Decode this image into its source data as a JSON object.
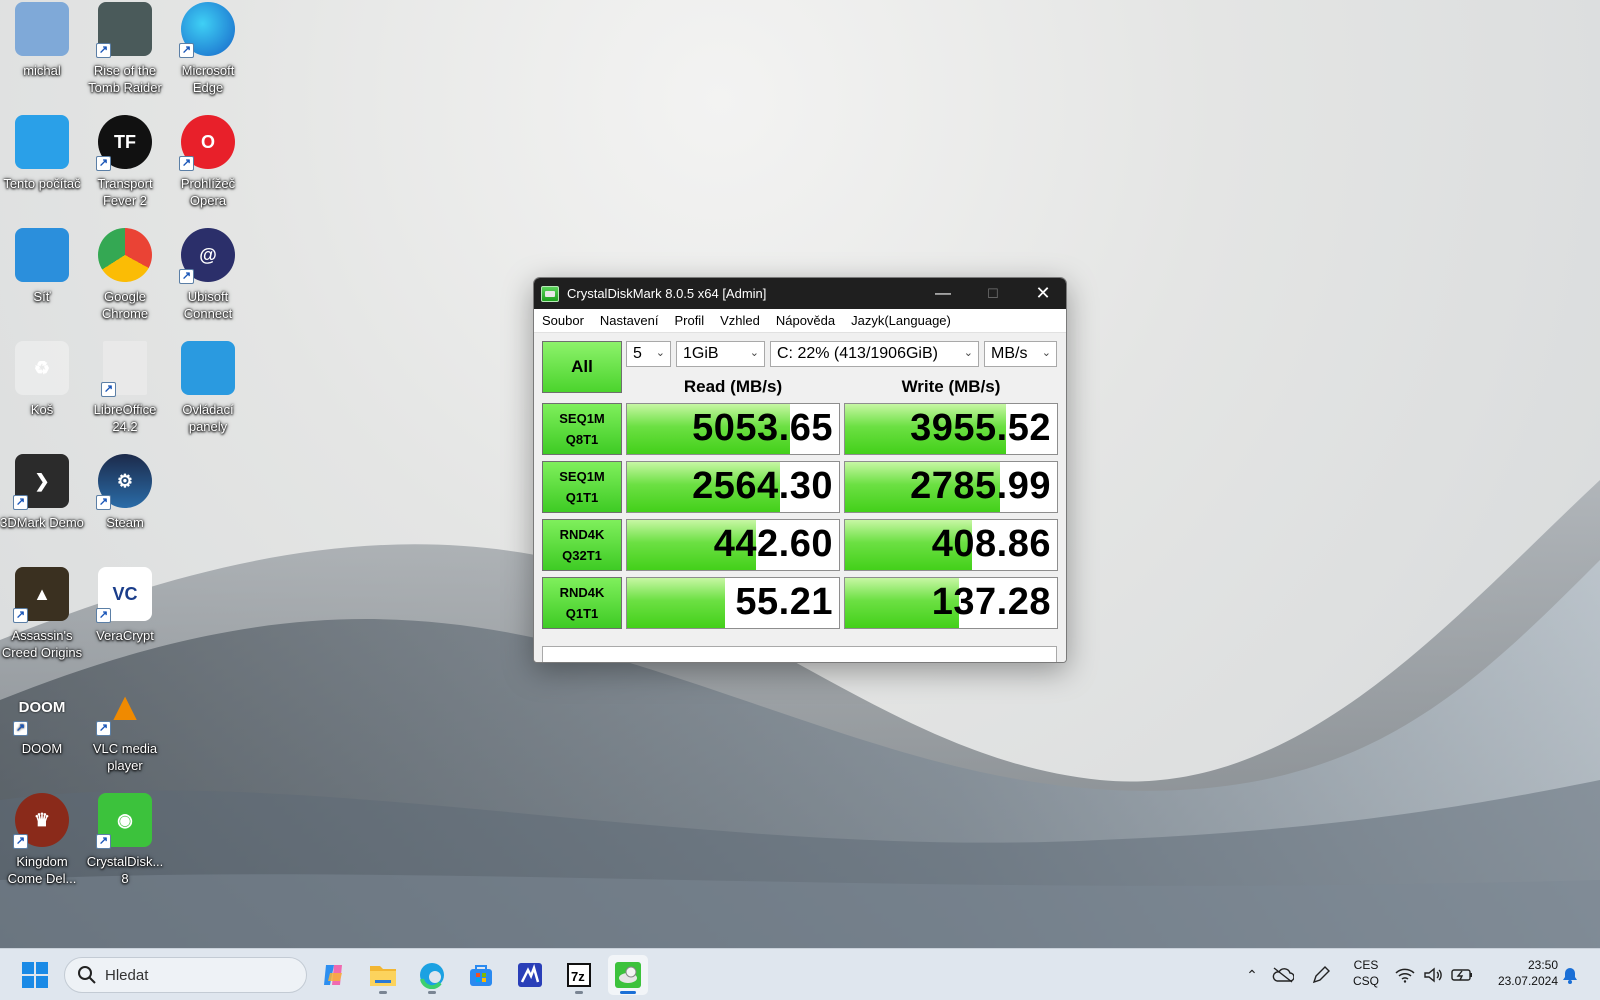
{
  "desktop": {
    "icons": [
      {
        "label": "michal"
      },
      {
        "label": "Rise of the Tomb Raider"
      },
      {
        "label": "Microsoft Edge"
      },
      {
        "label": "Tento počítač"
      },
      {
        "label": "Transport Fever 2"
      },
      {
        "label": "Prohlížeč Opera"
      },
      {
        "label": "Síť"
      },
      {
        "label": "Google Chrome"
      },
      {
        "label": "Ubisoft Connect"
      },
      {
        "label": "Koš"
      },
      {
        "label": "LibreOffice 24.2"
      },
      {
        "label": "Ovládací panely"
      },
      {
        "label": "3DMark Demo"
      },
      {
        "label": "Steam"
      },
      {
        "label": "Assassin's Creed Origins"
      },
      {
        "label": "VeraCrypt"
      },
      {
        "label": "DOOM"
      },
      {
        "label": "VLC media player"
      },
      {
        "label": "Kingdom Come Del..."
      },
      {
        "label": "CrystalDisk... 8"
      }
    ]
  },
  "window": {
    "title": "CrystalDiskMark 8.0.5 x64 [Admin]",
    "menu": [
      "Soubor",
      "Nastavení",
      "Profil",
      "Vzhled",
      "Nápověda",
      "Jazyk(Language)"
    ],
    "all_button": "All",
    "count_select": "5",
    "size_select": "1GiB",
    "drive_select": "C: 22% (413/1906GiB)",
    "unit_select": "MB/s",
    "read_header": "Read (MB/s)",
    "write_header": "Write (MB/s)",
    "tests": [
      {
        "line1": "SEQ1M",
        "line2": "Q8T1",
        "read": "5053.65",
        "write": "3955.52",
        "read_fill": 0.77,
        "write_fill": 0.76
      },
      {
        "line1": "SEQ1M",
        "line2": "Q1T1",
        "read": "2564.30",
        "write": "2785.99",
        "read_fill": 0.72,
        "write_fill": 0.73
      },
      {
        "line1": "RND4K",
        "line2": "Q32T1",
        "read": "442.60",
        "write": "408.86",
        "read_fill": 0.61,
        "write_fill": 0.6
      },
      {
        "line1": "RND4K",
        "line2": "Q1T1",
        "read": "55.21",
        "write": "137.28",
        "read_fill": 0.46,
        "write_fill": 0.54
      }
    ],
    "comment": ""
  },
  "taskbar": {
    "search_placeholder": "Hledat",
    "apps": [
      "copilot-icon",
      "file-explorer-icon",
      "edge-icon",
      "store-icon",
      "app-icon",
      "7zip-icon",
      "crystaldiskmark-icon"
    ],
    "lang_top": "CES",
    "lang_bottom": "CSQ",
    "time": "23:50",
    "date": "23.07.2024"
  },
  "colors": {
    "bar_green": "#43d01a",
    "button_green": "#4bd42d",
    "titlebar": "#1f1f1f"
  }
}
